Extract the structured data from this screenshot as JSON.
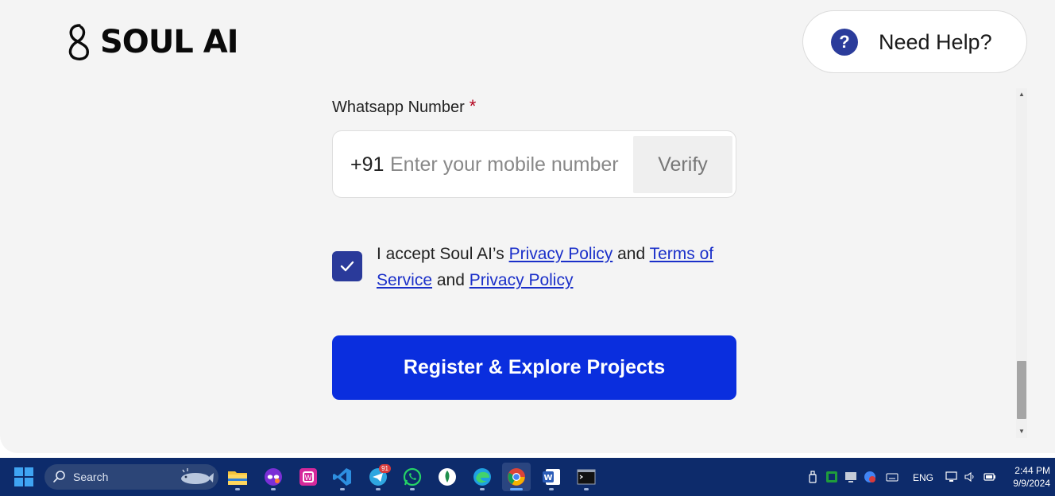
{
  "header": {
    "logo_text": "SOUL AI",
    "help_label": "Need Help?"
  },
  "form": {
    "whatsapp_label": "Whatsapp Number",
    "required_mark": "*",
    "country_code": "+91",
    "phone_placeholder": "Enter your mobile number",
    "phone_value": "",
    "verify_label": "Verify",
    "consent_checked": true,
    "consent_text_1": "I accept Soul AI’s",
    "privacy_link_1": "Privacy Policy",
    "consent_text_2": "and",
    "terms_link": "Terms of Service",
    "consent_text_3": "and",
    "privacy_link_2": "Privacy Policy",
    "register_label": "Register & Explore Projects"
  },
  "taskbar": {
    "search_label": "Search",
    "telegram_badge": "91",
    "language": "ENG",
    "time": "2:44 PM",
    "date": "9/9/2024"
  },
  "colors": {
    "accent": "#0a2ede",
    "checkbox": "#2a3a9a",
    "help_icon": "#2b3c9b",
    "link": "#1a2fc9",
    "required": "#b3001b",
    "taskbar": "#0d2b6b"
  },
  "icons": {
    "help": "question-circle-icon",
    "check": "checkmark-icon",
    "start": "windows-start-icon",
    "search": "search-icon"
  }
}
